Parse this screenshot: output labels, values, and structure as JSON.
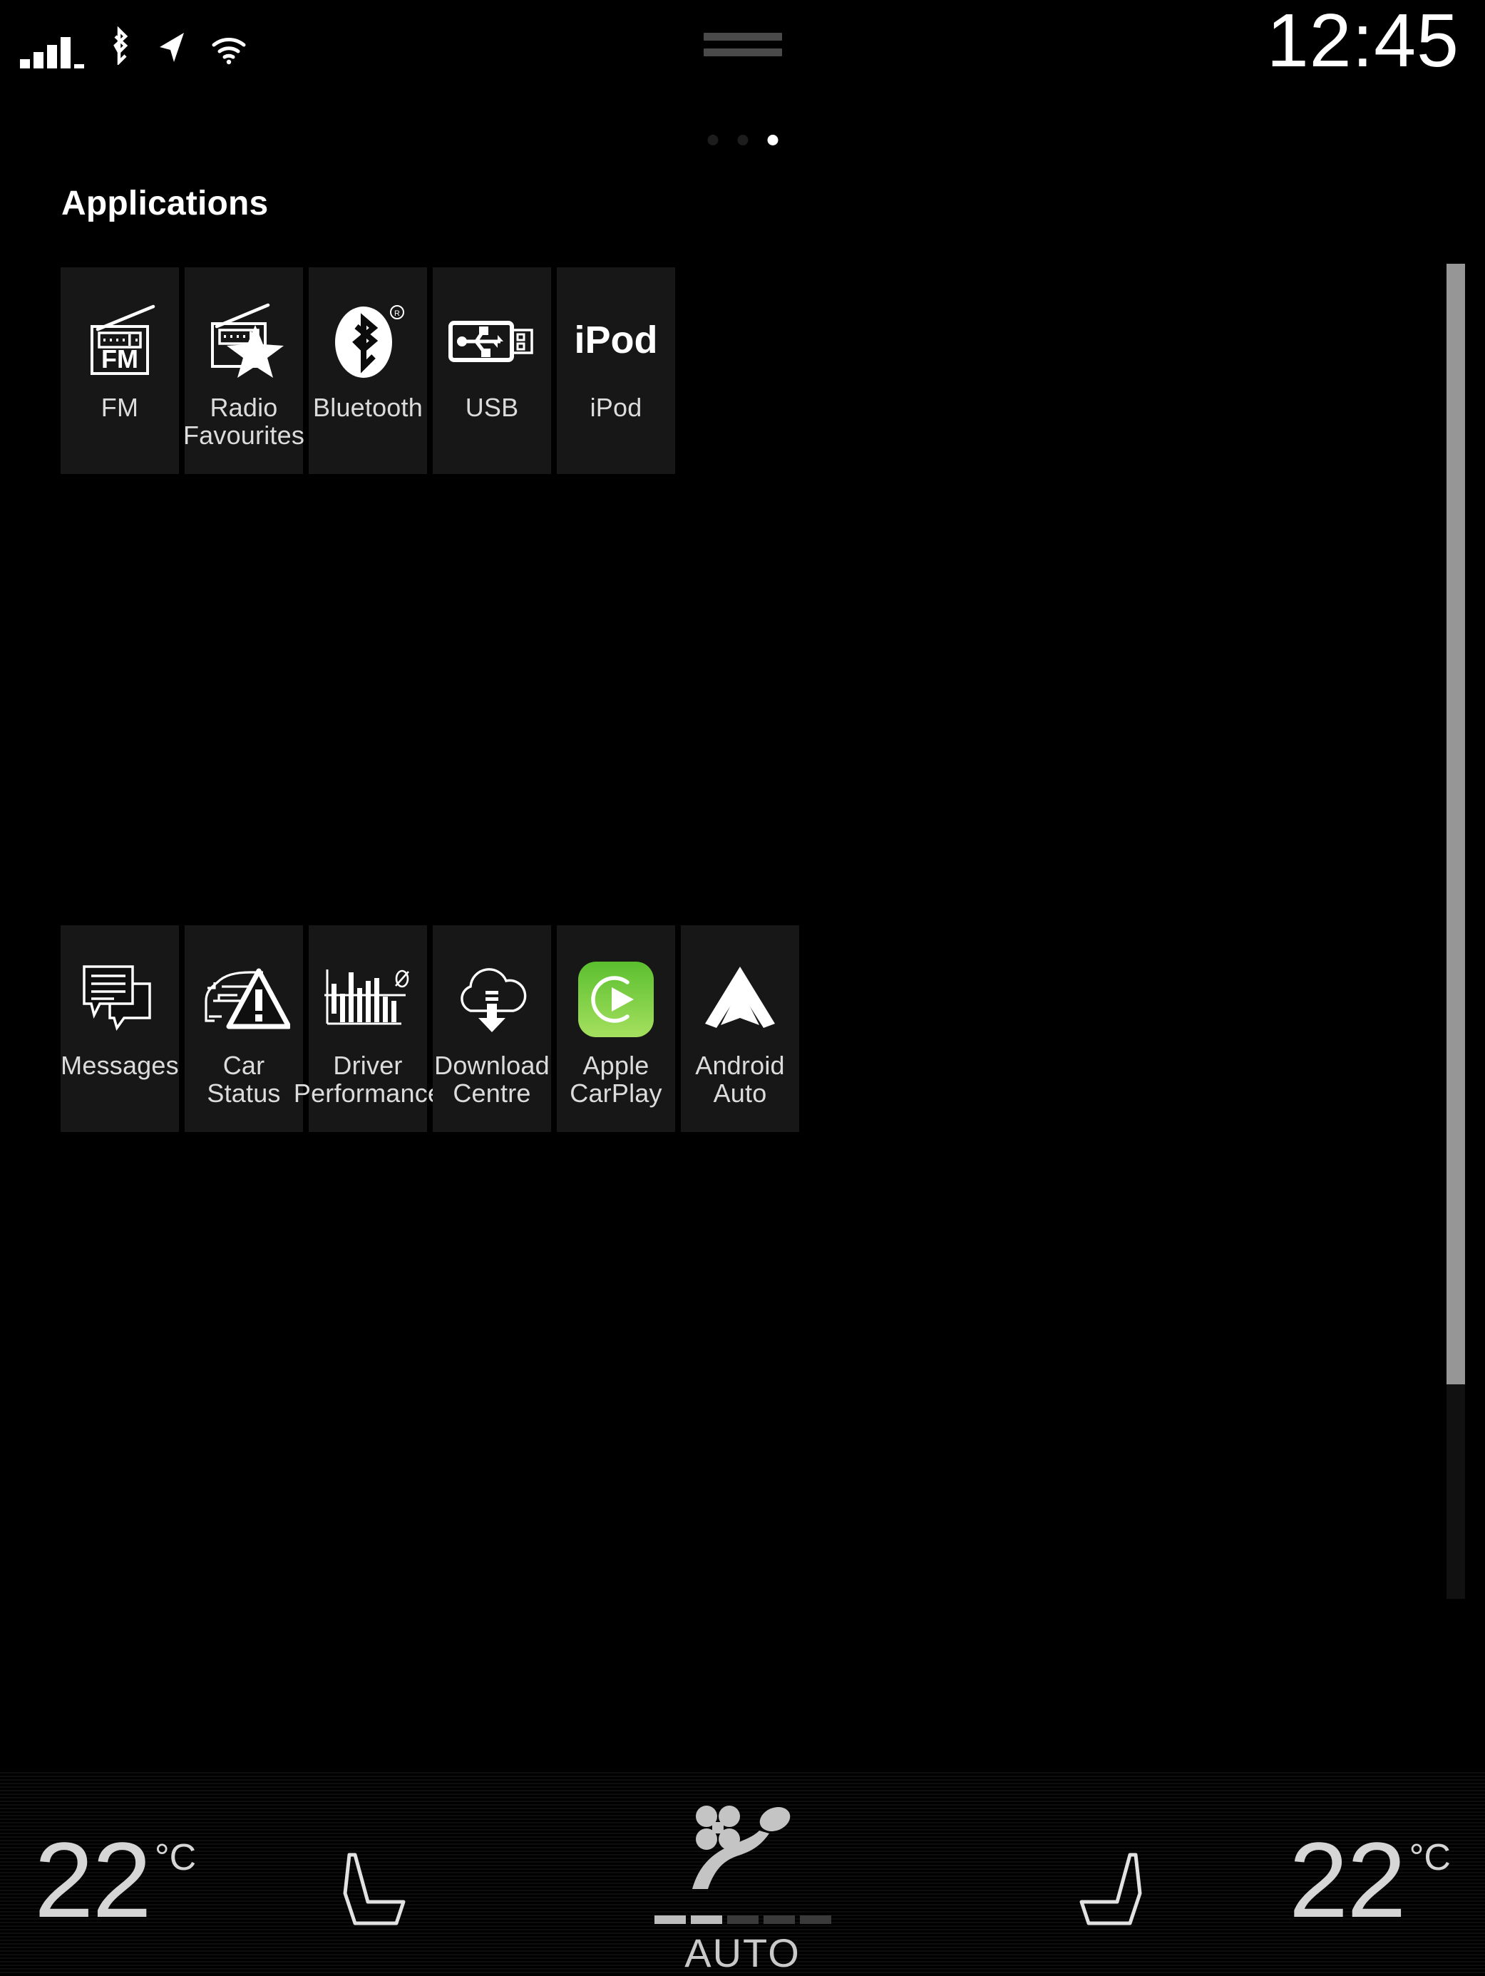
{
  "status_bar": {
    "signal_icon": "cellular-signal-icon",
    "bluetooth_icon": "bluetooth-icon",
    "navigation_icon": "navigation-arrow-icon",
    "wifi_icon": "wifi-icon",
    "drag_handle_icon": "drag-handle-icon",
    "time": "12:45"
  },
  "page_indicator": {
    "total": 3,
    "active_index": 2
  },
  "header": {
    "title": "Applications"
  },
  "apps": {
    "row1": [
      {
        "label": "FM",
        "icon": "fm-radio-icon"
      },
      {
        "label": "Radio\nFavourites",
        "icon": "radio-favourites-icon"
      },
      {
        "label": "Bluetooth",
        "icon": "bluetooth-logo-icon"
      },
      {
        "label": "USB",
        "icon": "usb-connector-icon"
      },
      {
        "label": "iPod",
        "icon": "ipod-wordmark-icon"
      }
    ],
    "row2": [
      {
        "label": "Messages",
        "icon": "messages-bubbles-icon"
      },
      {
        "label": "Car Status",
        "icon": "car-warning-icon"
      },
      {
        "label": "Driver\nPerformance",
        "icon": "bar-chart-average-icon"
      },
      {
        "label": "Download\nCentre",
        "icon": "cloud-download-icon"
      },
      {
        "label": "Apple\nCarPlay",
        "icon": "apple-carplay-icon"
      },
      {
        "label": "Android Auto",
        "icon": "android-auto-icon"
      }
    ]
  },
  "scrollbar": {
    "name": "vertical-scrollbar"
  },
  "climate": {
    "left_temp_value": "22",
    "left_temp_unit": "°C",
    "right_temp_value": "22",
    "right_temp_unit": "°C",
    "left_seat_icon": "seat-left-icon",
    "right_seat_icon": "seat-right-icon",
    "auto_icon": "auto-climate-seat-fan-icon",
    "auto_label": "AUTO",
    "fan_segments_total": 5,
    "fan_segments_active": 2
  },
  "colors": {
    "background": "#000000",
    "tile_background": "#171717",
    "text_primary": "#ffffff",
    "text_secondary": "#dcdcdc",
    "carplay_green": "#7ed321",
    "scrollbar_thumb": "#969696"
  }
}
